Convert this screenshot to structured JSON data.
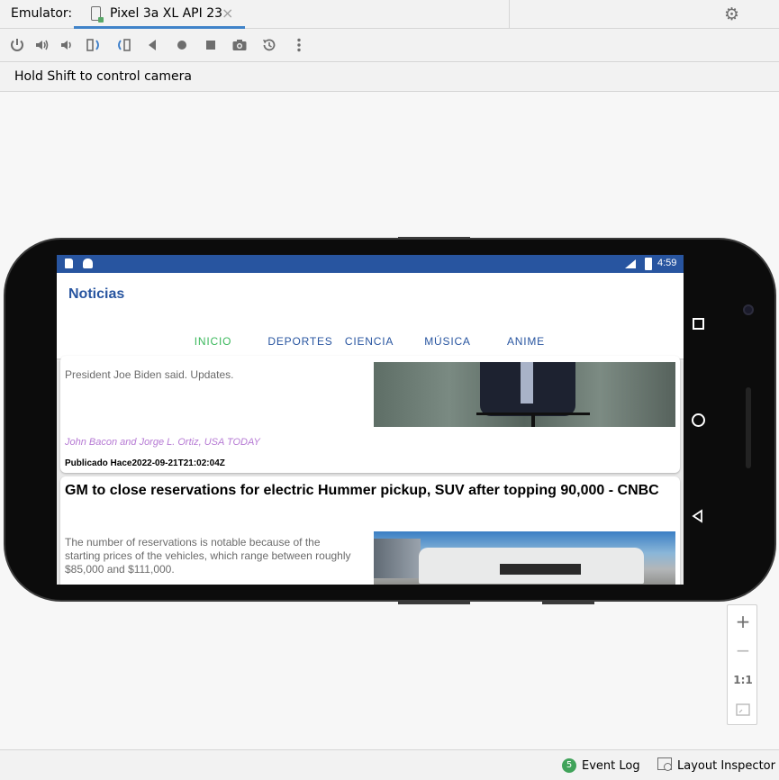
{
  "ide": {
    "emulator_label": "Emulator:",
    "device_tab": "Pixel 3a XL API 23",
    "tab_close": "×",
    "hint": "Hold Shift to control camera",
    "toolbar_icons": [
      "power-icon",
      "volume-up-icon",
      "volume-down-icon",
      "rotate-left-icon",
      "rotate-right-icon",
      "back-icon",
      "home-icon",
      "overview-icon",
      "screenshot-icon",
      "snapshot-icon",
      "more-icon"
    ],
    "zoom": {
      "in": "+",
      "out": "−",
      "actual": "1:1"
    },
    "bottom": {
      "event_log_count": "5",
      "event_log": "Event Log",
      "layout_inspector": "Layout Inspector"
    }
  },
  "phone": {
    "status_time": "4:59",
    "app_title": "Noticias",
    "tabs": [
      {
        "label": "INICIO"
      },
      {
        "label": "DEPORTES"
      },
      {
        "label": "CIENCIA"
      },
      {
        "label": "MÚSICA"
      },
      {
        "label": "ANIME"
      }
    ],
    "active_tab": "INICIO",
    "colors": {
      "primary": "#2855a0",
      "accent": "#3bb85c",
      "author": "#b67ad4"
    },
    "articles": [
      {
        "description": "President Joe Biden said. Updates.",
        "author": "John Bacon and Jorge L. Ortiz, USA TODAY",
        "published": "Publicado Hace2022-09-21T21:02:04Z"
      },
      {
        "title": "GM to close reservations for electric Hummer pickup, SUV after topping 90,000 - CNBC",
        "description": "The number of reservations is notable because of the starting prices of the vehicles, which range between roughly $85,000 and $111,000."
      }
    ]
  }
}
